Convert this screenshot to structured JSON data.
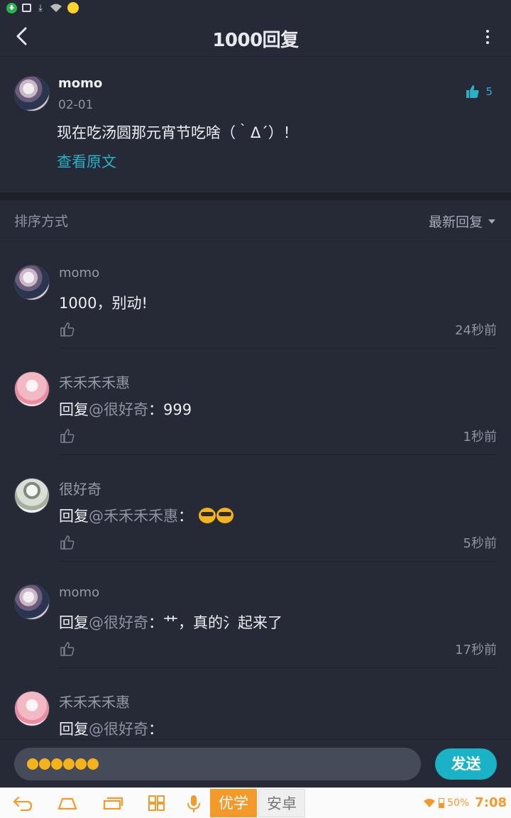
{
  "header": {
    "title": "1000回复"
  },
  "post": {
    "author": "momo",
    "date": "02-01",
    "content": "现在吃汤圆那元宵节吃啥（｀Δ´）！",
    "view_original": "查看原文",
    "like_count": "5"
  },
  "sort": {
    "label": "排序方式",
    "value": "最新回复"
  },
  "replies": [
    {
      "author": "momo",
      "prefix": "",
      "mention": "",
      "body": "1000，别动!",
      "time": "24秒前"
    },
    {
      "author": "禾禾禾禾惠",
      "prefix": "回复",
      "mention": "@很好奇",
      "body": "：999",
      "time": "1秒前"
    },
    {
      "author": "很好奇",
      "prefix": "回复",
      "mention": "@禾禾禾禾惠",
      "body": "：",
      "time": "5秒前"
    },
    {
      "author": "momo",
      "prefix": "回复",
      "mention": "@很好奇",
      "body": "：艹，真的氵起来了",
      "time": "17秒前"
    },
    {
      "author": "禾禾禾禾惠",
      "prefix": "回复",
      "mention": "@很好奇",
      "body": "：",
      "time": ""
    }
  ],
  "input": {
    "send_label": "发送"
  },
  "navbar": {
    "youxue": "优学",
    "anzhuo": "安卓",
    "battery": "50%",
    "clock": "7:08"
  },
  "colors": {
    "background": "#262a36",
    "accent": "#2ab0c6",
    "send": "#19b2c6",
    "nav_accent": "#f39a2b"
  }
}
